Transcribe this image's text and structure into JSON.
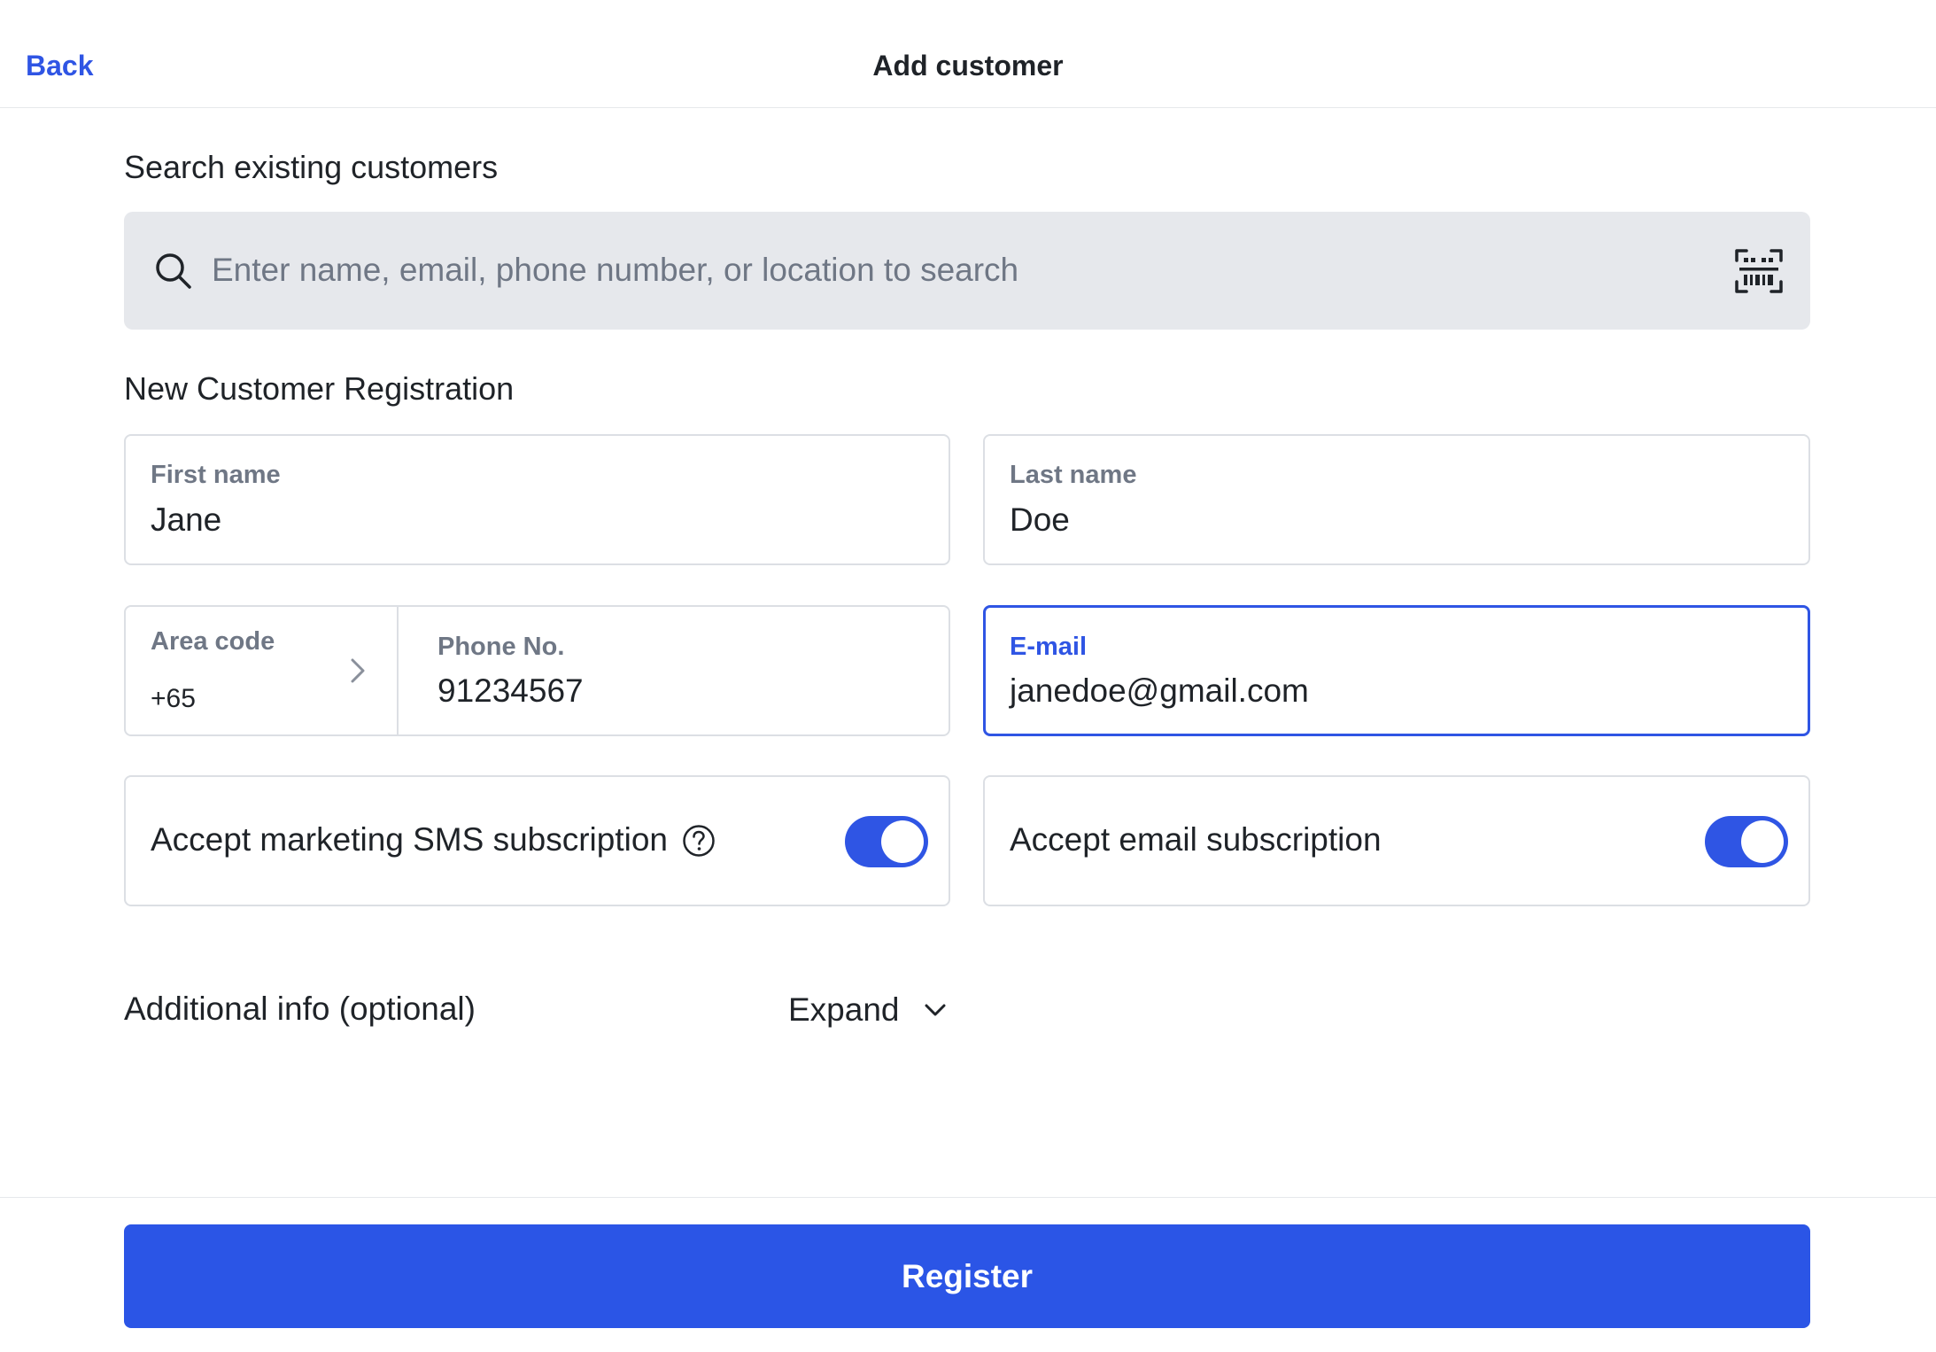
{
  "header": {
    "back_label": "Back",
    "title": "Add customer"
  },
  "search": {
    "heading": "Search existing customers",
    "placeholder": "Enter name, email, phone number, or location to search",
    "left_icon": "search-icon",
    "right_icon": "barcode-scan-icon"
  },
  "registration": {
    "heading": "New Customer Registration",
    "first_name": {
      "label": "First name",
      "value": "Jane"
    },
    "last_name": {
      "label": "Last name",
      "value": "Doe"
    },
    "area_code": {
      "label": "Area code",
      "value": "+65",
      "icon": "chevron-right-icon"
    },
    "phone": {
      "label": "Phone No.",
      "value": "91234567"
    },
    "email": {
      "label": "E-mail",
      "value": "janedoe@gmail.com",
      "focused": true
    },
    "sms_subscription": {
      "label": "Accept marketing SMS subscription",
      "help_icon": "question-circle-icon",
      "enabled": true
    },
    "email_subscription": {
      "label": "Accept email subscription",
      "enabled": true
    }
  },
  "additional_info": {
    "label": "Additional info (optional)",
    "expand_label": "Expand",
    "icon": "chevron-down-icon"
  },
  "footer": {
    "register_label": "Register"
  },
  "colors": {
    "accent": "#2f55e4",
    "button": "#2b55e6",
    "search_bg": "#e6e8ec",
    "border": "#dcdfe4",
    "muted_text": "#6f7785"
  }
}
